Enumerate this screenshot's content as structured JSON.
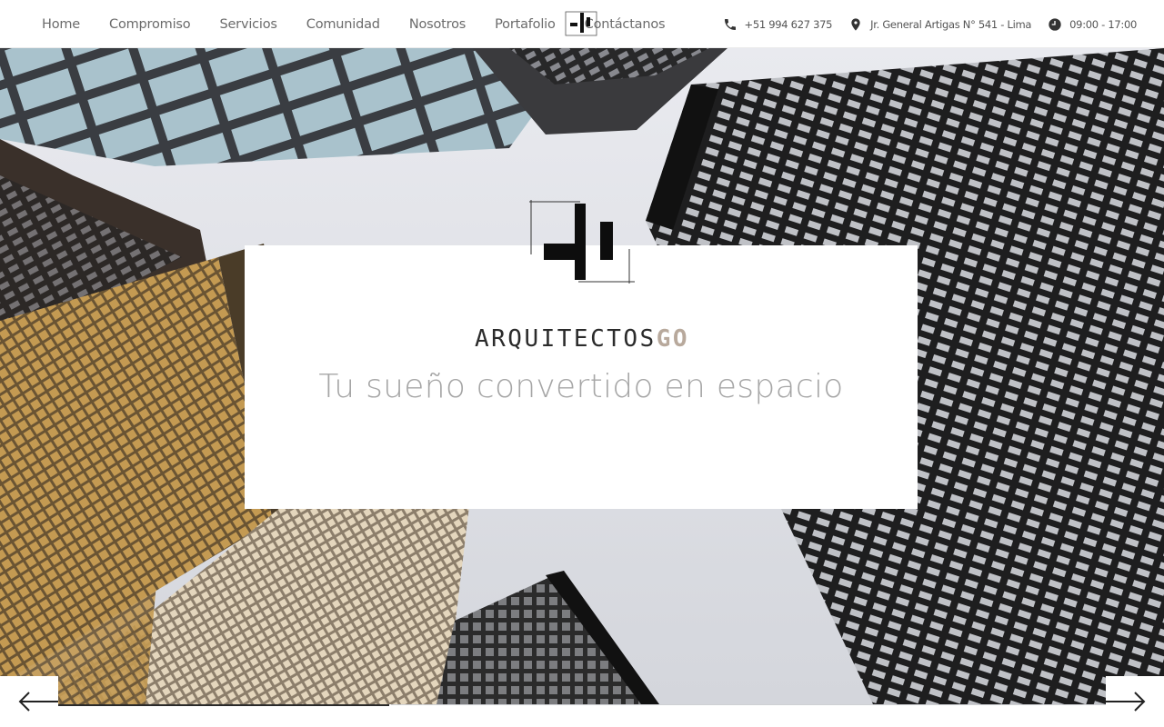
{
  "nav": {
    "links": [
      "Home",
      "Compromiso",
      "Servicios",
      "Comunidad",
      "Nosotros",
      "Portafolio",
      "Contáctanos"
    ]
  },
  "contact": {
    "phone": "+51 994 627 375",
    "address": "Jr. General Artigas N° 541 - Lima",
    "hours": "09:00 - 17:00",
    "phone_icon": "phone-icon",
    "address_icon": "map-pin-icon",
    "hours_icon": "clock-icon"
  },
  "hero": {
    "brand_main": "ARQUITECTOS",
    "brand_accent": "GO",
    "tagline": "Tu sueño convertido en espacio"
  },
  "slider": {
    "prev_icon": "arrow-left-icon",
    "next_icon": "arrow-right-icon"
  },
  "colors": {
    "accent": "#b8a99c",
    "text_dark": "#2b2b2b",
    "nav_text": "#6b6b6b",
    "tagline": "#a6a6a6"
  }
}
